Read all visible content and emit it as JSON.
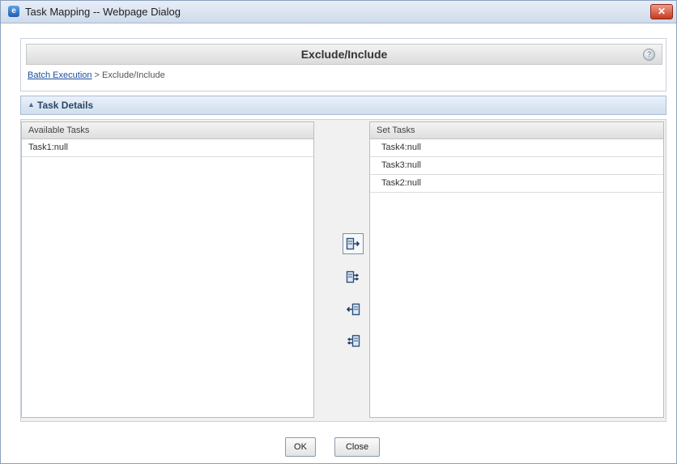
{
  "window": {
    "title": "Task Mapping -- Webpage Dialog",
    "close_glyph": "✕",
    "icon_glyph": "e"
  },
  "header": {
    "title": "Exclude/Include",
    "help_glyph": "?",
    "breadcrumb": {
      "link": "Batch Execution",
      "separator": " > ",
      "current": "Exclude/Include"
    }
  },
  "task_details": {
    "title": "Task Details",
    "collapse_glyph": "▲"
  },
  "available": {
    "header": "Available Tasks",
    "items": [
      "Task1:null"
    ]
  },
  "set": {
    "header": "Set Tasks",
    "items": [
      "Task4:null",
      "Task3:null",
      "Task2:null"
    ]
  },
  "move_buttons": [
    {
      "name": "move-selected-right-icon"
    },
    {
      "name": "move-all-right-icon"
    },
    {
      "name": "move-selected-left-icon"
    },
    {
      "name": "move-all-left-icon"
    }
  ],
  "footer": {
    "ok": "OK",
    "close": "Close"
  },
  "colors": {
    "accent": "#1b4e9b",
    "bar": "#cfdeee",
    "close": "#c63a22"
  }
}
